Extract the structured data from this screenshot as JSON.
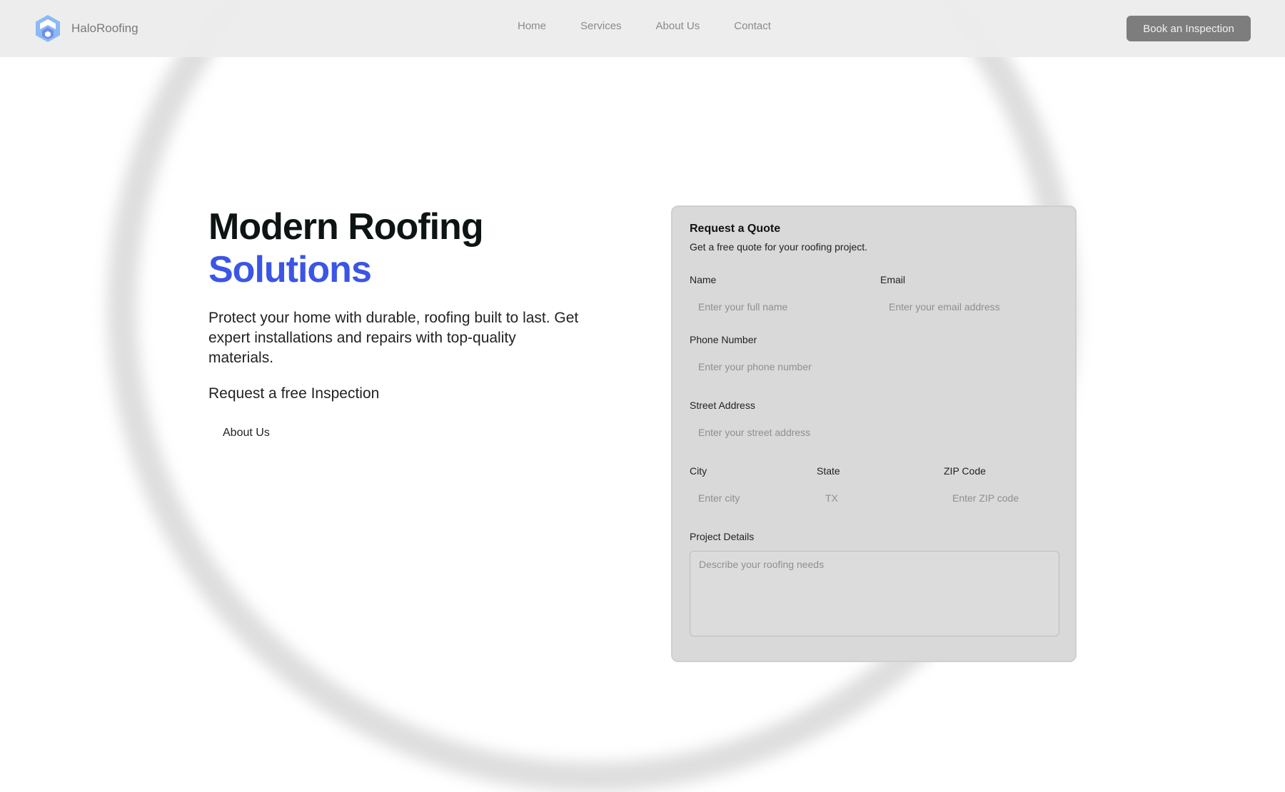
{
  "brand": {
    "name": "HaloRoofing"
  },
  "nav": {
    "items": [
      "Home",
      "Services",
      "About Us",
      "Contact"
    ],
    "cta": "Book an Inspection"
  },
  "hero": {
    "title_line1": "Modern Roofing",
    "title_line2": "Solutions",
    "description": "Protect your home with durable, roofing built to last. Get expert installations and repairs with top-quality materials.",
    "cta": "Request a free Inspection",
    "secondary": "About Us"
  },
  "form": {
    "title": "Request a Quote",
    "subtitle": "Get a free quote for your roofing project.",
    "name": {
      "label": "Name",
      "placeholder": "Enter your full name"
    },
    "email": {
      "label": "Email",
      "placeholder": "Enter your email address"
    },
    "phone": {
      "label": "Phone Number",
      "placeholder": "Enter your phone number"
    },
    "street": {
      "label": "Street Address",
      "placeholder": "Enter your street address"
    },
    "city": {
      "label": "City",
      "placeholder": "Enter city"
    },
    "state": {
      "label": "State",
      "placeholder": "TX"
    },
    "zip": {
      "label": "ZIP Code",
      "placeholder": "Enter ZIP code"
    },
    "details": {
      "label": "Project Details",
      "placeholder": "Describe your roofing needs"
    }
  },
  "colors": {
    "accent": "#3b55e6",
    "nav_bg": "#ececec",
    "card_bg": "#d9d9d9",
    "button_bg": "#7d7d7d"
  }
}
